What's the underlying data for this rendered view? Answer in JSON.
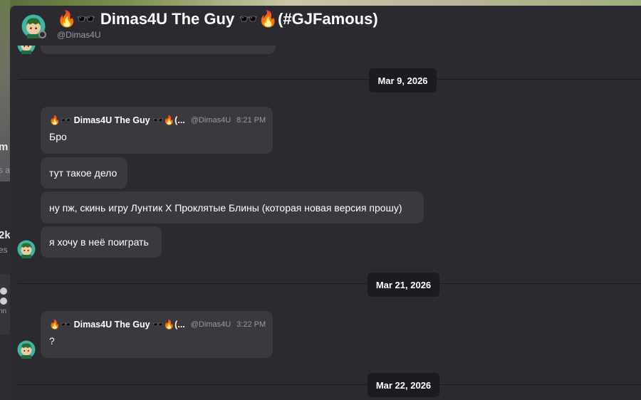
{
  "header": {
    "title": "🔥🕶️ Dimas4U The Guy 🕶️🔥(#GJFamous)",
    "handle": "@Dimas4U"
  },
  "background": {
    "fragments": [
      "m",
      "s a",
      "2k",
      "es",
      "nn"
    ]
  },
  "dividers": [
    {
      "date": "Mar 9, 2026"
    },
    {
      "date": "Mar 21, 2026"
    },
    {
      "date": "Mar 22, 2026"
    }
  ],
  "groups": [
    {
      "author": "🔥🕶️ Dimas4U The Guy 🕶️🔥(...",
      "handle": "@Dimas4U",
      "time": "8:21 PM",
      "messages": [
        "Бро",
        "тут такое дело",
        "ну пж, скинь игру Лунтик X Проклятые Блины (которая новая версия прошу)",
        "я хочу в неё поиграть"
      ]
    },
    {
      "author": "🔥🕶️ Dimas4U The Guy 🕶️🔥(...",
      "handle": "@Dimas4U",
      "time": "3:22 PM",
      "messages": [
        "?"
      ]
    }
  ],
  "colors": {
    "background": "#2b2a30",
    "bubble": "#3a3940",
    "date_pill": "#1c1b20",
    "muted_text": "#9a9aa2",
    "avatar_ring": "#3fb5a3",
    "avatar_face": "#f2c9a0",
    "avatar_hair": "#2e6b2e"
  },
  "icons": {
    "avatar": "person-avatar-icon",
    "status": "offline-status-icon"
  }
}
